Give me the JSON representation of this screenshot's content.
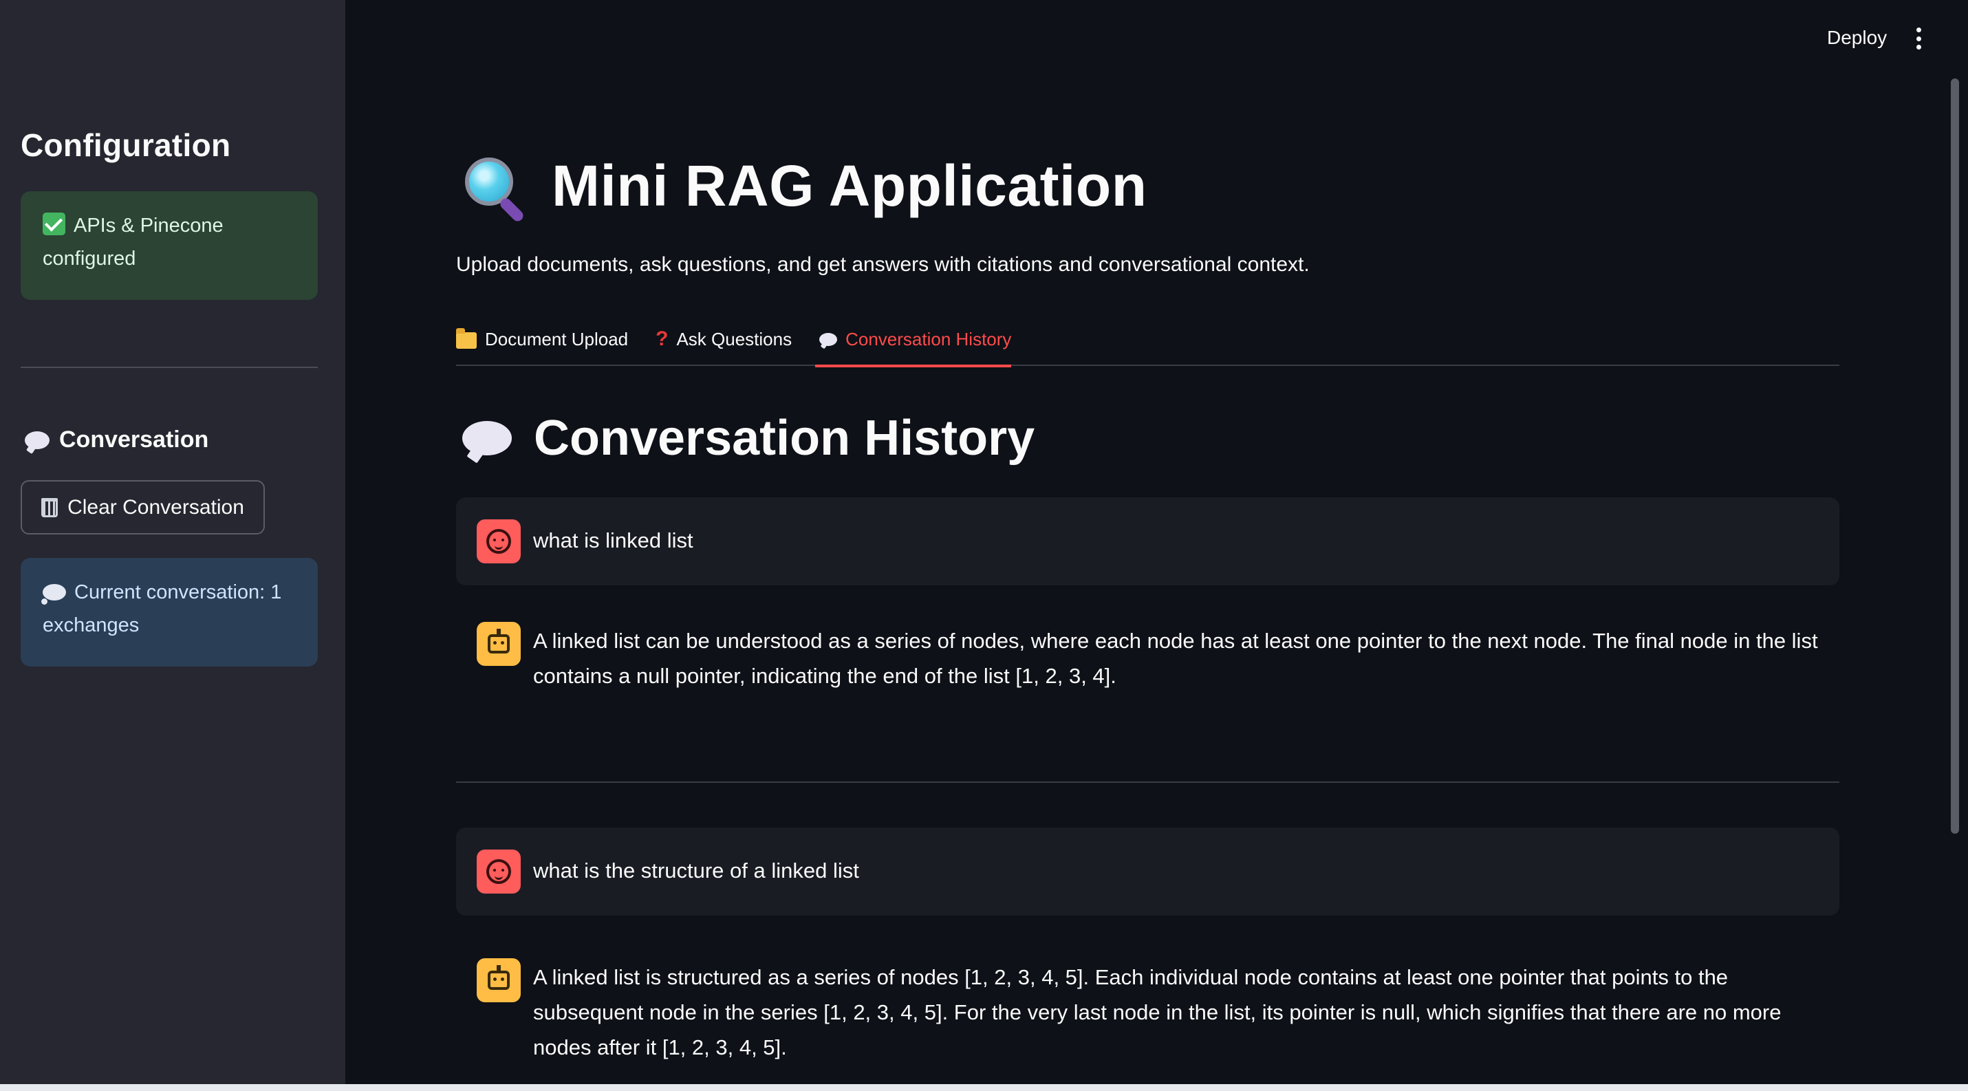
{
  "sidebar": {
    "title": "Configuration",
    "status_alert": "APIs & Pinecone configured",
    "conversation_header": "Conversation",
    "clear_button": "Clear Conversation",
    "conversation_info": "Current conversation: 1 exchanges"
  },
  "header": {
    "deploy_label": "Deploy"
  },
  "main": {
    "title": "Mini RAG Application",
    "subtitle": "Upload documents, ask questions, and get answers with citations and conversational context.",
    "tabs": [
      {
        "label": "Document Upload",
        "icon": "folder-icon"
      },
      {
        "label": "Ask Questions",
        "icon": "question-mark-icon"
      },
      {
        "label": "Conversation History",
        "icon": "speech-balloon-icon",
        "active": true
      }
    ],
    "section_title": "Conversation History",
    "messages": [
      {
        "role": "user",
        "text": "what is linked list"
      },
      {
        "role": "assistant",
        "text": "A linked list can be understood as a series of nodes, where each node has at least one pointer to the next node. The final node in the list contains a null pointer, indicating the end of the list [1, 2, 3, 4]."
      },
      {
        "role": "user",
        "text": "what is the structure of a linked list"
      },
      {
        "role": "assistant",
        "text": "A linked list is structured as a series of nodes [1, 2, 3, 4, 5]. Each individual node contains at least one pointer that points to the subsequent node in the series [1, 2, 3, 4, 5]. For the very last node in the list, its pointer is null, which signifies that there are no more nodes after it [1, 2, 3, 4, 5]."
      }
    ]
  },
  "colors": {
    "background": "#0e1117",
    "sidebar": "#262730",
    "accent": "#ff4b4b",
    "success_bg": "#2b4433",
    "info_bg": "#2a3e56",
    "user_avatar": "#ff5c5c",
    "assistant_avatar": "#ffbd45"
  }
}
